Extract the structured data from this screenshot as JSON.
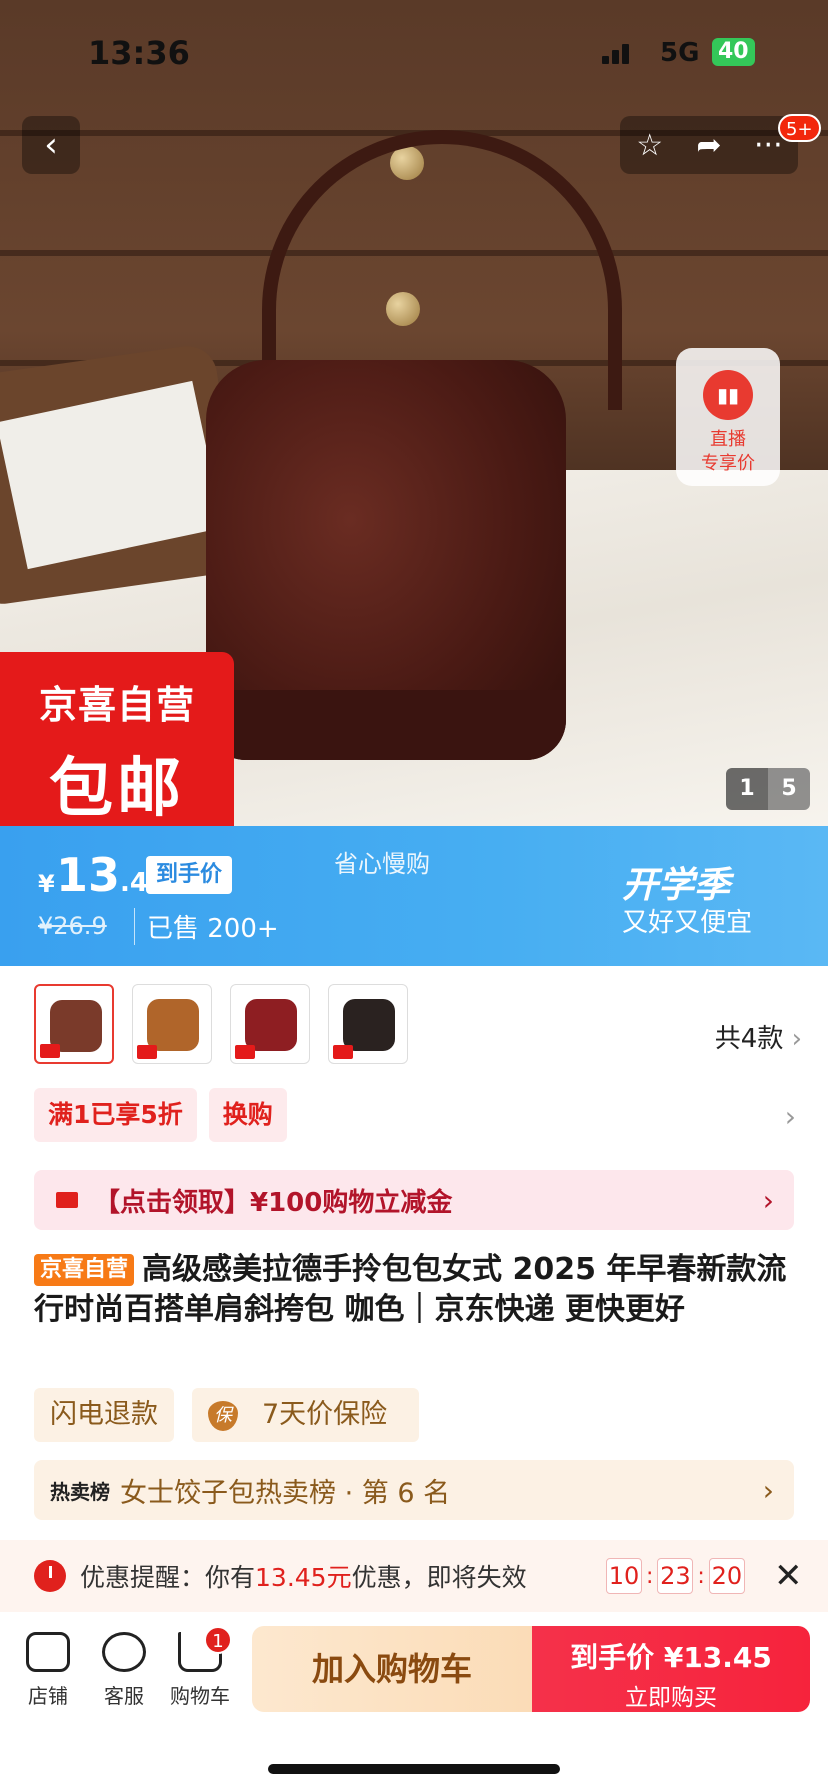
{
  "status_bar": {
    "time": "13:36",
    "network": "5G",
    "battery": "40"
  },
  "header": {
    "back_icon": "chevron-left-icon",
    "action_icons": [
      "star-icon",
      "share-icon",
      "more-icon"
    ],
    "badge": "5+"
  },
  "hero": {
    "live_label_1": "直播",
    "live_label_2": "专享价",
    "banner_line1": "京喜自营",
    "banner_line2": "包邮",
    "pager_current": "1",
    "pager_total": "5"
  },
  "price": {
    "currency": "¥",
    "integer": "13",
    "decimal": ".45",
    "tag": "到手价",
    "slogan": "省心慢购",
    "original": "¥26.9",
    "sold": "已售 200+",
    "season_title": "开学季",
    "season_sub": "又好又便宜"
  },
  "variants": {
    "count_label": "共4款",
    "swatches": [
      "#7a3a2a",
      "#b0652a",
      "#8e1e22",
      "#2a2220"
    ]
  },
  "promos": {
    "chip1": "满1已享5折",
    "chip2": "换购"
  },
  "coupon": {
    "text": "【点击领取】¥100购物立减金"
  },
  "product": {
    "badge": "京喜自营",
    "title": "高级感美拉德手拎包包女式 2025 年早春新款流行时尚百搭单肩斜挎包 咖色｜京东快递 更快更好"
  },
  "services": {
    "s1": "闪电退款",
    "s2_icon": "保",
    "s2": "7天价保险"
  },
  "rank": {
    "label": "热卖榜",
    "text": "女士饺子包热卖榜 · 第 6 名"
  },
  "reminder": {
    "prefix": "优惠提醒：你有",
    "amount": "13.45元",
    "suffix": "优惠，即将失效",
    "hours": "10",
    "minutes": "23",
    "seconds": "20"
  },
  "bottom_bar": {
    "store": "店铺",
    "service": "客服",
    "cart": "购物车",
    "cart_badge": "1",
    "add_to_cart": "加入购物车",
    "buy_line1": "到手价 ¥13.45",
    "buy_line2": "立即购买"
  }
}
